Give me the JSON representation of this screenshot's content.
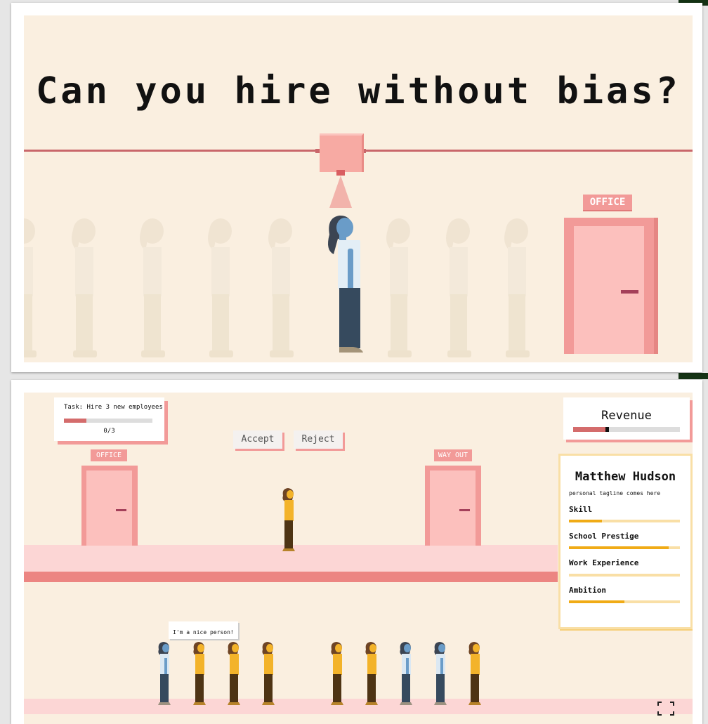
{
  "title": "Can you hire without bias?",
  "top_scene": {
    "office_sign": "OFFICE"
  },
  "game": {
    "task": {
      "label": "Task: Hire 3 new employees",
      "counter": "0/3",
      "progress": 0.25
    },
    "revenue": {
      "label": "Revenue",
      "level": 0.3
    },
    "buttons": {
      "accept": "Accept",
      "reject": "Reject"
    },
    "signs": {
      "office": "OFFICE",
      "way_out": "WAY OUT"
    },
    "speech_bubble": "I'm a nice person!",
    "candidate": {
      "name": "Matthew Hudson",
      "tagline": "personal tagline comes here",
      "attributes": [
        {
          "label": "Skill",
          "value": 0.3
        },
        {
          "label": "School Prestige",
          "value": 0.9
        },
        {
          "label": "Work Experience",
          "value": 0.0
        },
        {
          "label": "Ambition",
          "value": 0.5
        }
      ]
    },
    "fullscreen_icon": "fullscreen-icon"
  },
  "colors": {
    "background": "#faefe0",
    "accent_pink": "#f29a98",
    "blue_person": "#6a9cc8",
    "yellow_person": "#f3b32a",
    "bar_fill": "#f0ab16"
  }
}
